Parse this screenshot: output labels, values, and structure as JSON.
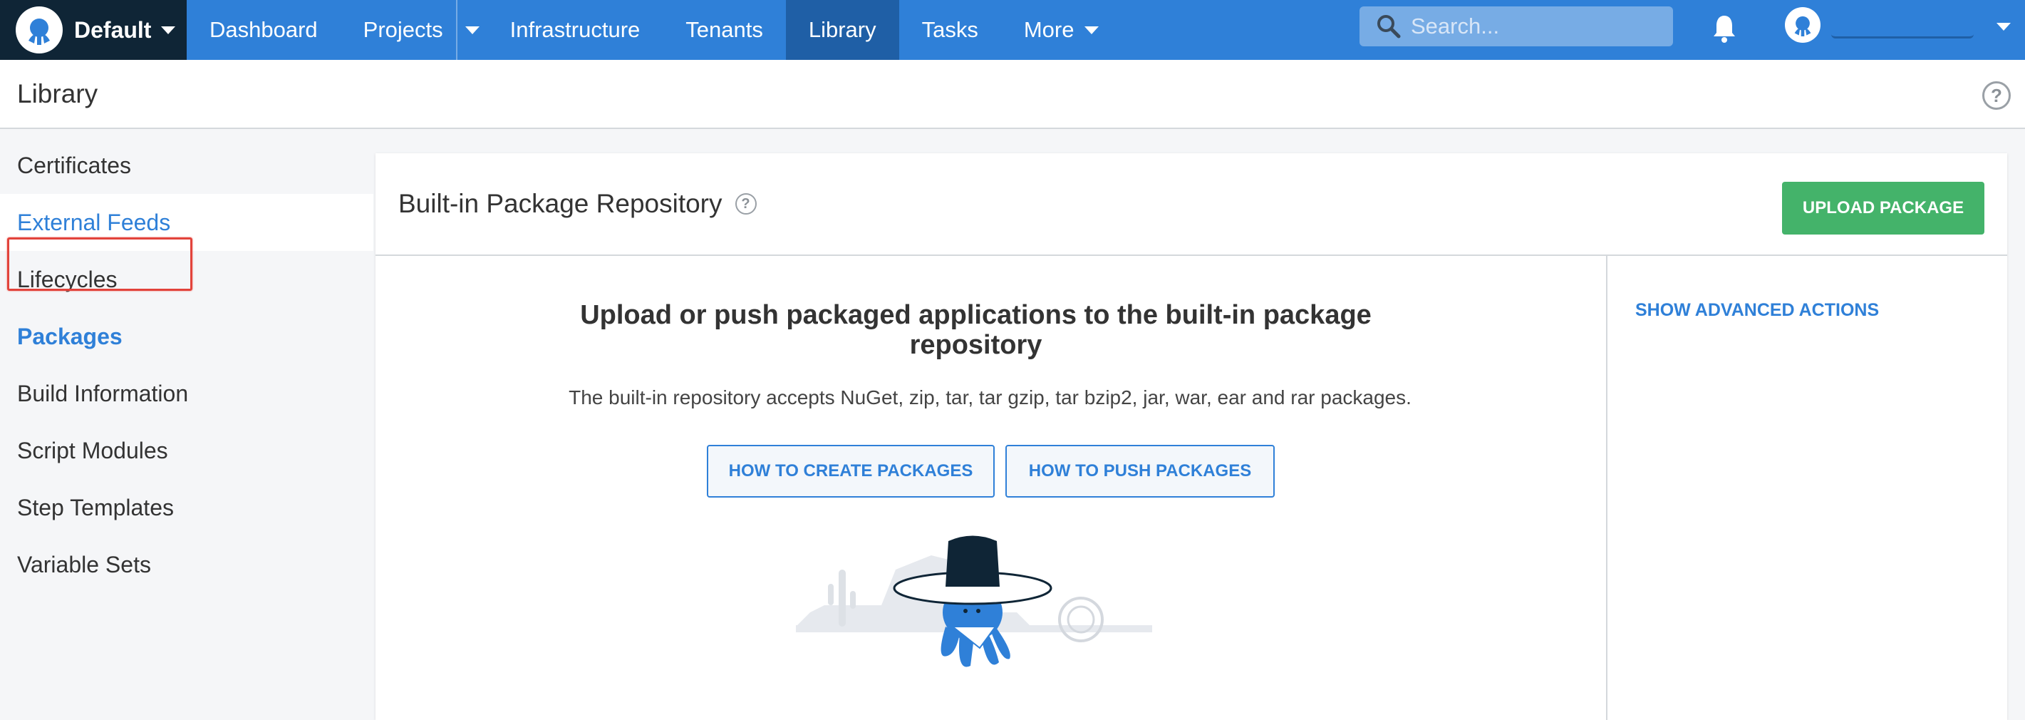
{
  "topbar": {
    "space_name": "Default",
    "nav": {
      "dashboard": "Dashboard",
      "projects": "Projects",
      "infrastructure": "Infrastructure",
      "tenants": "Tenants",
      "library": "Library",
      "tasks": "Tasks",
      "more": "More"
    },
    "search_placeholder": "Search...",
    "colors": {
      "bar": "#2f80d8",
      "active": "#1f5fa6",
      "space": "#0f2536"
    }
  },
  "header": {
    "title": "Library"
  },
  "sidebar": {
    "items": [
      {
        "label": "Certificates"
      },
      {
        "label": "External Feeds"
      },
      {
        "label": "Lifecycles"
      },
      {
        "label": "Packages"
      },
      {
        "label": "Build Information"
      },
      {
        "label": "Script Modules"
      },
      {
        "label": "Step Templates"
      },
      {
        "label": "Variable Sets"
      }
    ]
  },
  "panel": {
    "title": "Built-in Package Repository",
    "upload_button": "UPLOAD PACKAGE",
    "advanced_actions": "SHOW ADVANCED ACTIONS",
    "empty_title": "Upload or push packaged applications to the built-in package repository",
    "empty_subtitle": "The built-in repository accepts NuGet, zip, tar, tar gzip, tar bzip2, jar, war, ear and rar packages.",
    "how_create": "HOW TO CREATE PACKAGES",
    "how_push": "HOW TO PUSH PACKAGES",
    "colors": {
      "primary": "#44b36a",
      "link": "#2f80d8"
    }
  }
}
